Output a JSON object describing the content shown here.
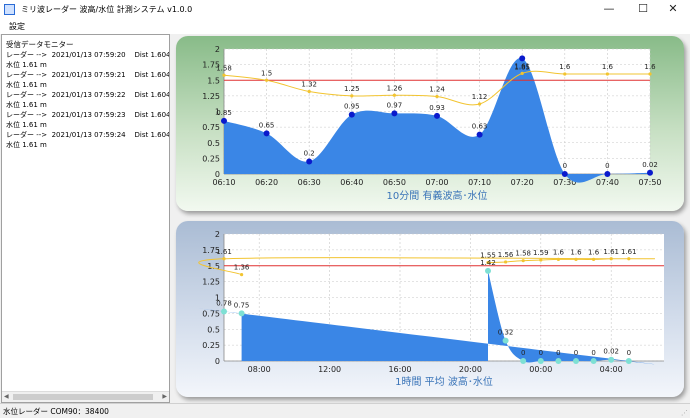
{
  "window": {
    "title": "ミリ波レーダー 波高/水位 計測システム v1.0.0",
    "minimize_glyph": "—",
    "maximize_glyph": "☐",
    "close_glyph": "✕"
  },
  "menu": {
    "settings_label": "設定"
  },
  "monitor": {
    "heading": "受信データモニター",
    "lines": [
      "レーダー -->  2021/01/13 07:59:20    Dist 1.604 m",
      "水位 1.61 m",
      "レーダー -->  2021/01/13 07:59:21    Dist 1.604 m",
      "水位 1.61 m",
      "レーダー -->  2021/01/13 07:59:22    Dist 1.604 m",
      "水位 1.61 m",
      "レーダー -->  2021/01/13 07:59:23    Dist 1.604 m",
      "水位 1.61 m",
      "レーダー -->  2021/01/13 07:59:24    Dist 1.604 m",
      "水位 1.61 m"
    ]
  },
  "status": {
    "text": "水位レーダー  COM90：38400"
  },
  "colors": {
    "area": "#3a86e6",
    "line": "#f2c430",
    "threshold": "#e03030",
    "point1": "#0a1acc",
    "point2": "#7ee0d4"
  },
  "chart_data": [
    {
      "type": "area",
      "title": "10分間  有義波高･水位",
      "ylim": [
        0,
        2
      ],
      "yticks": [
        "0",
        "0.25",
        "0.5",
        "0.75",
        "1",
        "1.25",
        "1.5",
        "1.75",
        "2"
      ],
      "categories": [
        "06:10",
        "06:20",
        "06:30",
        "06:40",
        "06:50",
        "07:00",
        "07:10",
        "07:20",
        "07:30",
        "07:40",
        "07:50"
      ],
      "threshold": 1.5,
      "series": [
        {
          "values": [
            0.85,
            0.65,
            0.2,
            0.95,
            0.97,
            0.93,
            0.63,
            1.85,
            0,
            0,
            0.02
          ],
          "labels": [
            "0.85",
            "0.65",
            "0.2",
            "0.95",
            "0.97",
            "0.93",
            "0.63",
            "1.85",
            "0",
            "0",
            "0.02"
          ]
        },
        {
          "values": [
            1.58,
            1.5,
            1.32,
            1.25,
            1.26,
            1.24,
            1.12,
            1.61,
            1.6,
            1.6,
            1.6
          ],
          "labels": [
            "1.58",
            "1.5",
            "1.32",
            "1.25",
            "1.26",
            "1.24",
            "1.12",
            "1.61",
            "1.6",
            "1.6",
            "1.6"
          ]
        }
      ]
    },
    {
      "type": "area",
      "title": "1時間  平均 波高･水位",
      "ylim": [
        0,
        2
      ],
      "yticks": [
        "0",
        "0.25",
        "0.5",
        "0.75",
        "1",
        "1.25",
        "1.5",
        "1.75",
        "2"
      ],
      "x_range": [
        "06:00",
        "07:00"
      ],
      "xticks": [
        "08:00",
        "12:00",
        "16:00",
        "20:00",
        "00:00",
        "04:00"
      ],
      "threshold": 1.5,
      "series": [
        {
          "x": [
            "21:00",
            "22:00",
            "23:00",
            "00:00",
            "01:00",
            "02:00",
            "03:00",
            "04:00",
            "05:00",
            "06:00",
            "07:00"
          ],
          "values": [
            1.42,
            0.32,
            0,
            0,
            0,
            0,
            0,
            0.02,
            0,
            0.78,
            0.75
          ],
          "labels": [
            "1.42",
            "0.32",
            "0",
            "0",
            "0",
            "0",
            "0",
            "0.02",
            "0",
            "0.78",
            "0.75"
          ]
        },
        {
          "x": [
            "21:00",
            "22:00",
            "23:00",
            "00:00",
            "01:00",
            "02:00",
            "03:00",
            "04:00",
            "05:00",
            "06:00",
            "07:00"
          ],
          "values": [
            1.55,
            1.56,
            1.58,
            1.59,
            1.6,
            1.6,
            1.6,
            1.61,
            1.61,
            1.61,
            1.36
          ],
          "labels": [
            "1.55",
            "1.56",
            "1.58",
            "1.59",
            "1.6",
            "1.6",
            "1.6",
            "1.61",
            "1.61",
            "1.61",
            "1.36"
          ]
        }
      ]
    }
  ]
}
